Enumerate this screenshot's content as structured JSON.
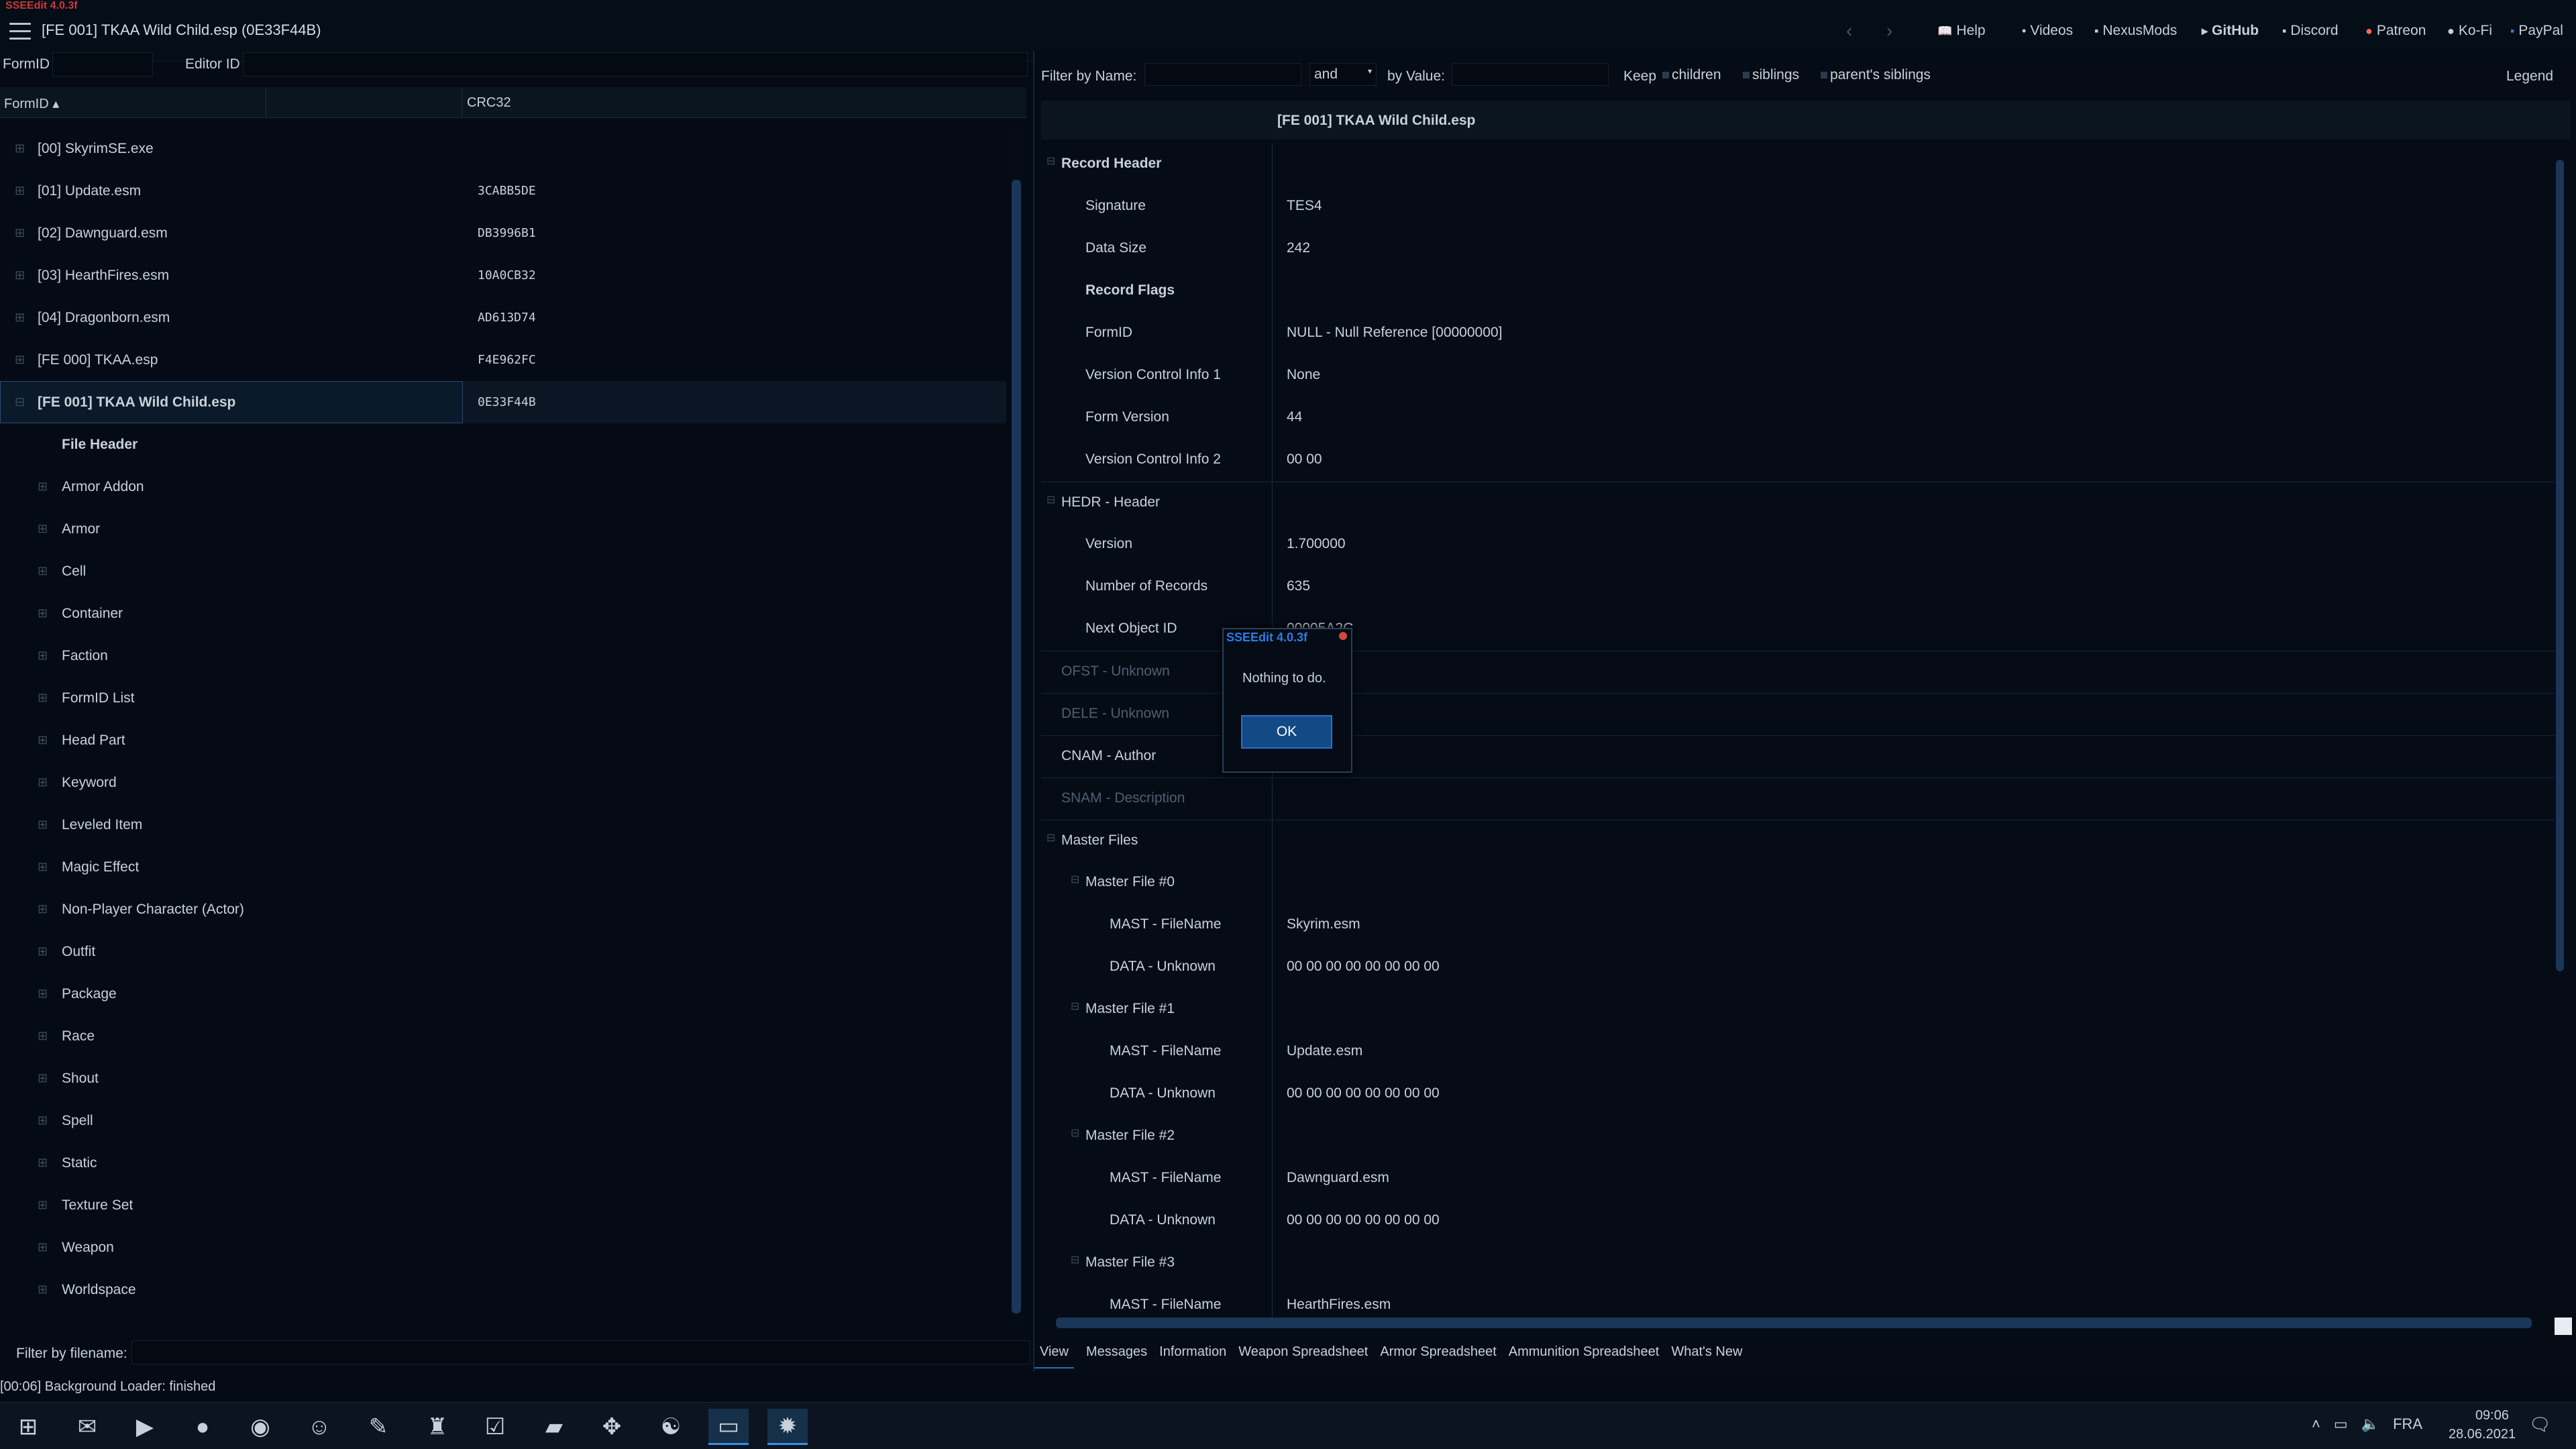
{
  "app": {
    "badge": "SSEEdit 4.0.3f",
    "window_title": "[FE 001] TKAA Wild Child.esp (0E33F44B)"
  },
  "nav": {
    "back": "‹",
    "forward": "›"
  },
  "top_links": [
    {
      "label": "Help",
      "icon": "book-icon"
    },
    {
      "label": "Videos",
      "icon": "dot-icon"
    },
    {
      "label": "NexusMods",
      "icon": "nexus-icon"
    },
    {
      "label": "GitHub",
      "icon": "github-icon"
    },
    {
      "label": "Discord",
      "icon": "discord-icon"
    },
    {
      "label": "Patreon",
      "icon": "patreon-icon"
    },
    {
      "label": "Ko-Fi",
      "icon": "kofi-icon"
    },
    {
      "label": "PayPal",
      "icon": "paypal-icon"
    }
  ],
  "left": {
    "formid_label": "FormID",
    "editorid_label": "Editor ID",
    "columns": {
      "formid": "FormID ▴",
      "crc": "CRC32"
    },
    "rows": [
      {
        "label": "[00] SkyrimSE.exe",
        "crc": ""
      },
      {
        "label": "[01] Update.esm",
        "crc": "3CABB5DE"
      },
      {
        "label": "[02] Dawnguard.esm",
        "crc": "DB3996B1"
      },
      {
        "label": "[03] HearthFires.esm",
        "crc": "10A0CB32"
      },
      {
        "label": "[04] Dragonborn.esm",
        "crc": "AD613D74"
      },
      {
        "label": "[FE 000] TKAA.esp",
        "crc": "F4E962FC"
      },
      {
        "label": "[FE 001] TKAA Wild Child.esp",
        "crc": "0E33F44B"
      }
    ],
    "children": [
      "File Header",
      "Armor Addon",
      "Armor",
      "Cell",
      "Container",
      "Faction",
      "FormID List",
      "Head Part",
      "Keyword",
      "Leveled Item",
      "Magic Effect",
      "Non-Player Character (Actor)",
      "Outfit",
      "Package",
      "Race",
      "Shout",
      "Spell",
      "Static",
      "Texture Set",
      "Weapon",
      "Worldspace"
    ],
    "filter_filename_label": "Filter by filename:",
    "status": "[00:06] Background Loader: finished"
  },
  "right": {
    "filter_name_label": "Filter by Name:",
    "and_value": "and",
    "by_value_label": "by Value:",
    "keep_label": "Keep",
    "keep_children": "children",
    "keep_siblings": "siblings",
    "keep_parents": "parent's siblings",
    "legend": "Legend",
    "record_title": "[FE 001] TKAA Wild Child.esp",
    "rows": [
      {
        "name": "Record Header",
        "value": "",
        "indent": 1,
        "bold": true,
        "exp": true,
        "grp": false,
        "dim": false
      },
      {
        "name": "Signature",
        "value": "TES4",
        "indent": 2,
        "bold": false,
        "exp": false,
        "grp": false,
        "dim": false
      },
      {
        "name": "Data Size",
        "value": "242",
        "indent": 2,
        "bold": false,
        "exp": false,
        "grp": false,
        "dim": false
      },
      {
        "name": "Record Flags",
        "value": "",
        "indent": 2,
        "bold": true,
        "exp": false,
        "grp": false,
        "dim": false
      },
      {
        "name": "FormID",
        "value": "NULL - Null Reference [00000000]",
        "indent": 2,
        "bold": false,
        "exp": false,
        "grp": false,
        "dim": false
      },
      {
        "name": "Version Control Info 1",
        "value": "None",
        "indent": 2,
        "bold": false,
        "exp": false,
        "grp": false,
        "dim": false
      },
      {
        "name": "Form Version",
        "value": "44",
        "indent": 2,
        "bold": false,
        "exp": false,
        "grp": false,
        "dim": false
      },
      {
        "name": "Version Control Info 2",
        "value": "00 00",
        "indent": 2,
        "bold": false,
        "exp": false,
        "grp": false,
        "dim": false
      },
      {
        "name": "HEDR - Header",
        "value": "",
        "indent": 1,
        "bold": false,
        "exp": true,
        "grp": true,
        "dim": false
      },
      {
        "name": "Version",
        "value": "1.700000",
        "indent": 2,
        "bold": false,
        "exp": false,
        "grp": false,
        "dim": false
      },
      {
        "name": "Number of Records",
        "value": "635",
        "indent": 2,
        "bold": false,
        "exp": false,
        "grp": false,
        "dim": false
      },
      {
        "name": "Next Object ID",
        "value": "00005A2C",
        "indent": 2,
        "bold": false,
        "exp": false,
        "grp": false,
        "dim": false
      },
      {
        "name": "OFST - Unknown",
        "value": "",
        "indent": 1,
        "bold": false,
        "exp": false,
        "grp": true,
        "dim": true
      },
      {
        "name": "DELE - Unknown",
        "value": "",
        "indent": 1,
        "bold": false,
        "exp": false,
        "grp": true,
        "dim": true
      },
      {
        "name": "CNAM - Author",
        "value": "",
        "indent": 1,
        "bold": false,
        "exp": false,
        "grp": true,
        "dim": false
      },
      {
        "name": "SNAM - Description",
        "value": "",
        "indent": 1,
        "bold": false,
        "exp": false,
        "grp": true,
        "dim": true
      },
      {
        "name": "Master Files",
        "value": "",
        "indent": 1,
        "bold": false,
        "exp": true,
        "grp": true,
        "dim": false
      },
      {
        "name": "Master File #0",
        "value": "",
        "indent": 2,
        "bold": false,
        "exp": true,
        "grp": false,
        "dim": false
      },
      {
        "name": "MAST - FileName",
        "value": "Skyrim.esm",
        "indent": 3,
        "bold": false,
        "exp": false,
        "grp": false,
        "dim": false
      },
      {
        "name": "DATA - Unknown",
        "value": "00 00 00 00 00 00 00 00",
        "indent": 3,
        "bold": false,
        "exp": false,
        "grp": false,
        "dim": false
      },
      {
        "name": "Master File #1",
        "value": "",
        "indent": 2,
        "bold": false,
        "exp": true,
        "grp": false,
        "dim": false
      },
      {
        "name": "MAST - FileName",
        "value": "Update.esm",
        "indent": 3,
        "bold": false,
        "exp": false,
        "grp": false,
        "dim": false
      },
      {
        "name": "DATA - Unknown",
        "value": "00 00 00 00 00 00 00 00",
        "indent": 3,
        "bold": false,
        "exp": false,
        "grp": false,
        "dim": false
      },
      {
        "name": "Master File #2",
        "value": "",
        "indent": 2,
        "bold": false,
        "exp": true,
        "grp": false,
        "dim": false
      },
      {
        "name": "MAST - FileName",
        "value": "Dawnguard.esm",
        "indent": 3,
        "bold": false,
        "exp": false,
        "grp": false,
        "dim": false
      },
      {
        "name": "DATA - Unknown",
        "value": "00 00 00 00 00 00 00 00",
        "indent": 3,
        "bold": false,
        "exp": false,
        "grp": false,
        "dim": false
      },
      {
        "name": "Master File #3",
        "value": "",
        "indent": 2,
        "bold": false,
        "exp": true,
        "grp": false,
        "dim": false
      },
      {
        "name": "MAST - FileName",
        "value": "HearthFires.esm",
        "indent": 3,
        "bold": false,
        "exp": false,
        "grp": false,
        "dim": false
      }
    ],
    "tabs": [
      "View",
      "Messages",
      "Information",
      "Weapon Spreadsheet",
      "Armor Spreadsheet",
      "Ammunition Spreadsheet",
      "What's New"
    ]
  },
  "dialog": {
    "title": "SSEEdit 4.0.3f",
    "message": "Nothing to do.",
    "ok_label": "OK"
  },
  "taskbar": {
    "apps": [
      {
        "icon": "windows-start-icon",
        "glyph": "⊞"
      },
      {
        "icon": "mail-icon",
        "glyph": "✉"
      },
      {
        "icon": "media-player-icon",
        "glyph": "▶"
      },
      {
        "icon": "red-app-icon",
        "glyph": "●"
      },
      {
        "icon": "whatsapp-icon",
        "glyph": "◉"
      },
      {
        "icon": "discord-app-icon",
        "glyph": "☺"
      },
      {
        "icon": "feather-app-icon",
        "glyph": "✎"
      },
      {
        "icon": "helmet-app-icon",
        "glyph": "♜"
      },
      {
        "icon": "checkbox-app-icon",
        "glyph": "☑"
      },
      {
        "icon": "file-explorer-icon",
        "glyph": "▰"
      },
      {
        "icon": "gamepad-icon",
        "glyph": "✥"
      },
      {
        "icon": "chat-app-icon",
        "glyph": "☯"
      },
      {
        "icon": "window-app-icon",
        "glyph": "▭"
      },
      {
        "icon": "xedit-app-icon",
        "glyph": "✹"
      }
    ],
    "lang": "FRA",
    "time": "09:06",
    "date": "28.06.2021"
  }
}
